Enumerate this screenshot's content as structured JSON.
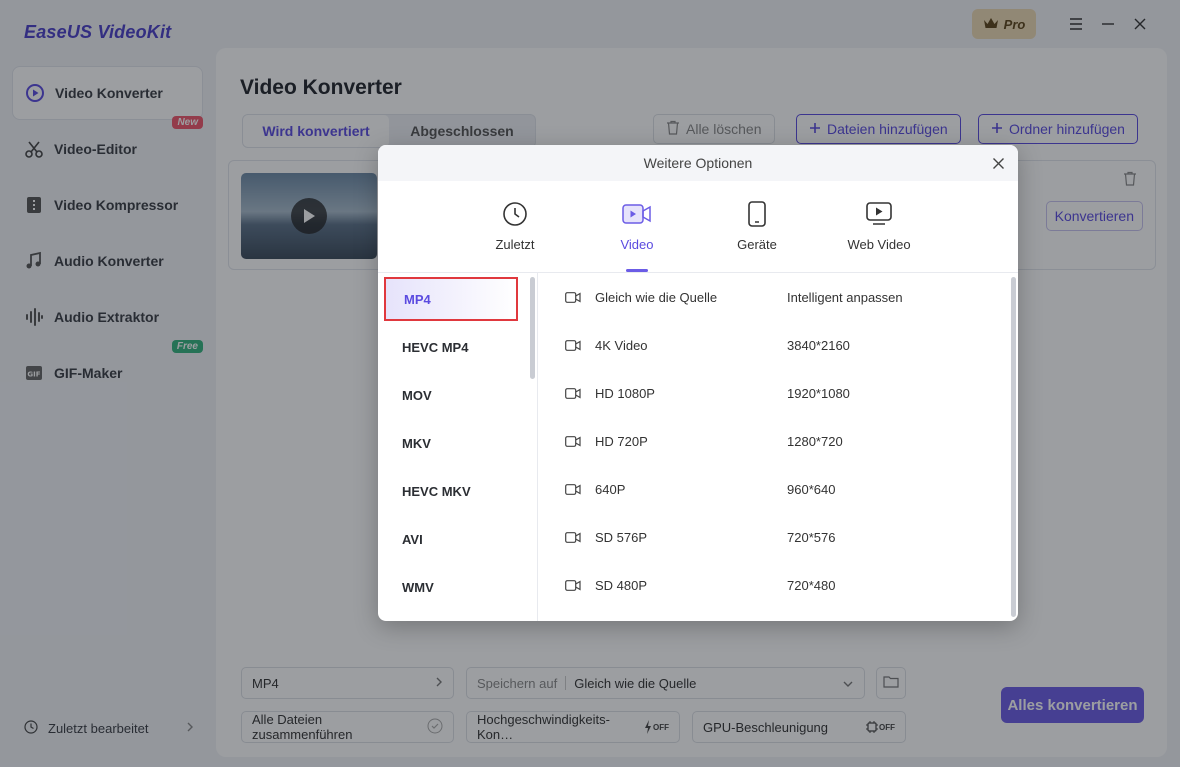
{
  "app": {
    "brand": "EaseUS VideoKit",
    "pro_label": "Pro"
  },
  "sidebar": {
    "items": [
      {
        "label": "Video Konverter",
        "icon": "convert-icon",
        "active": true
      },
      {
        "label": "Video-Editor",
        "icon": "scissors-icon",
        "tag": "New"
      },
      {
        "label": "Video Kompressor",
        "icon": "compress-icon"
      },
      {
        "label": "Audio Konverter",
        "icon": "music-note-icon"
      },
      {
        "label": "Audio Extraktor",
        "icon": "waveform-icon"
      },
      {
        "label": "GIF-Maker",
        "icon": "gif-icon",
        "tag": "Free"
      }
    ],
    "recent_label": "Zuletzt bearbeitet"
  },
  "main": {
    "title": "Video Konverter",
    "tabs": [
      "Wird konvertiert",
      "Abgeschlossen"
    ],
    "clear_all": "Alle löschen",
    "add_files": "Dateien hinzufügen",
    "add_folder": "Ordner hinzufügen",
    "convert_label": "Konvertieren",
    "output_format": "MP4",
    "save_to_label": "Speichern auf",
    "save_to_value": "Gleich wie die Quelle",
    "merge_label": "Alle Dateien zusammenführen",
    "highspeed_label": "Hochgeschwindigkeits-Kon…",
    "gpu_label": "GPU-Beschleunigung",
    "off_label": "OFF",
    "convert_all": "Alles konvertieren"
  },
  "modal": {
    "title": "Weitere Optionen",
    "tabs": [
      {
        "label": "Zuletzt",
        "icon": "clock-icon"
      },
      {
        "label": "Video",
        "icon": "video-icon",
        "active": true
      },
      {
        "label": "Geräte",
        "icon": "phone-icon"
      },
      {
        "label": "Web Video",
        "icon": "web-video-icon"
      }
    ],
    "formats": [
      "MP4",
      "HEVC MP4",
      "MOV",
      "MKV",
      "HEVC MKV",
      "AVI",
      "WMV"
    ],
    "selected_format": "MP4",
    "presets": [
      {
        "name": "Gleich wie die Quelle",
        "res": "Intelligent anpassen"
      },
      {
        "name": "4K Video",
        "res": "3840*2160"
      },
      {
        "name": "HD 1080P",
        "res": "1920*1080"
      },
      {
        "name": "HD 720P",
        "res": "1280*720"
      },
      {
        "name": "640P",
        "res": "960*640"
      },
      {
        "name": "SD 576P",
        "res": "720*576"
      },
      {
        "name": "SD 480P",
        "res": "720*480"
      }
    ]
  },
  "colors": {
    "accent": "#6b5ce6",
    "highlight_box": "#e0383e"
  }
}
